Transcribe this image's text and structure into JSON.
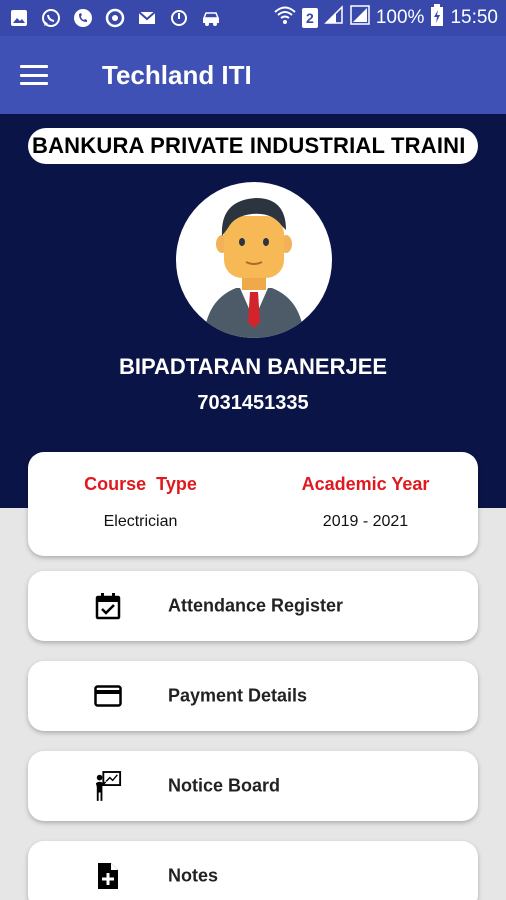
{
  "status_bar": {
    "battery": "100%",
    "time": "15:50",
    "sim": "2",
    "icons": [
      "image-icon",
      "whatsapp-icon",
      "phone-icon",
      "chrome-icon",
      "mail-icon",
      "sync-icon",
      "car-icon",
      "wifi-icon",
      "sim2-icon",
      "signal-icon",
      "battery-icon"
    ]
  },
  "app_bar": {
    "title": "Techland ITI",
    "menu_icon": "hamburger-icon"
  },
  "profile": {
    "institute": "BANKURA PRIVATE INDUSTRIAL TRAINI",
    "name": "BIPADTARAN BANERJEE",
    "phone": "7031451335",
    "avatar_icon": "businessman-avatar-icon"
  },
  "info": {
    "course_label": "Course  Type",
    "course_value": "Electrician",
    "year_label": "Academic Year",
    "year_value": "2019 - 2021",
    "label_color": "#e0191f"
  },
  "menu": [
    {
      "label": "Attendance Register",
      "icon": "calendar-check-icon"
    },
    {
      "label": "Payment Details",
      "icon": "credit-card-icon"
    },
    {
      "label": "Notice Board",
      "icon": "presentation-board-icon"
    },
    {
      "label": "Notes",
      "icon": "note-add-icon"
    }
  ],
  "colors": {
    "status_bar": "#3949ab",
    "app_bar": "#3f51b5",
    "hero": "#0b1446",
    "background": "#e6e6e6"
  }
}
